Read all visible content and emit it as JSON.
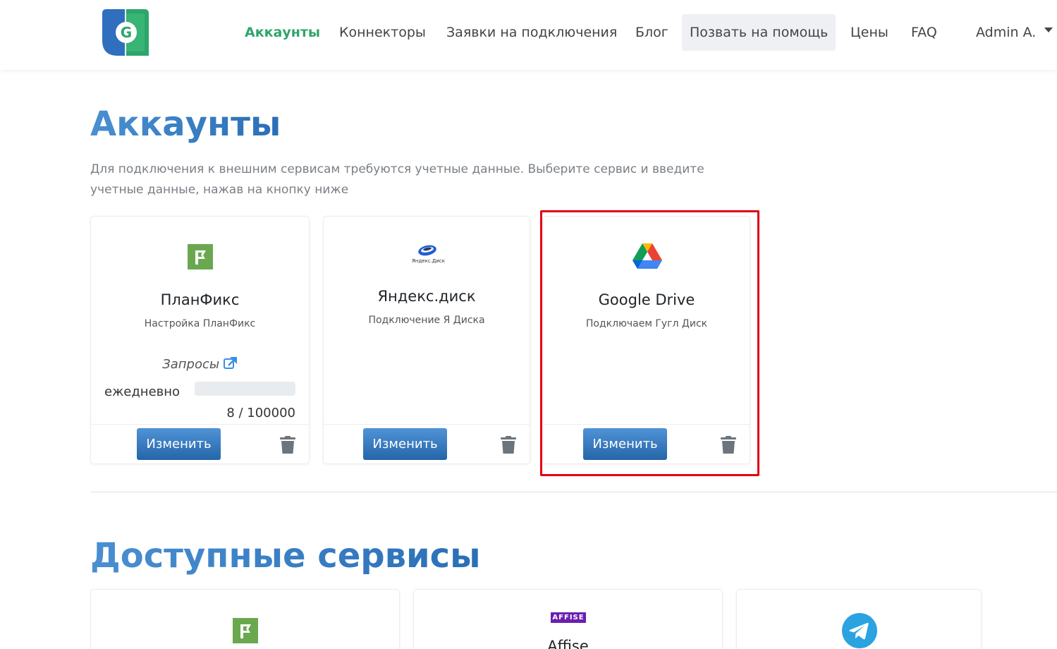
{
  "nav": {
    "items": [
      {
        "label": "Аккаунты",
        "active": true
      },
      {
        "label": "Коннекторы"
      },
      {
        "label": "Заявки на подключения"
      },
      {
        "label": "Блог"
      },
      {
        "label": "Позвать на помощь",
        "boxed": true
      },
      {
        "label": "Цены"
      },
      {
        "label": "FAQ"
      }
    ],
    "user": "Admin A."
  },
  "accounts": {
    "title": "Аккаунты",
    "subtitle": "Для подключения к внешним сервисам требуются учетные данные. Выберите сервис и введите учетные данные, нажав на кнопку ниже",
    "cards": [
      {
        "name": "ПланФикс",
        "description": "Настройка ПланФикс",
        "requests_label": "Запросы",
        "period_label": "ежедневно",
        "usage": "8 / 100000",
        "usage_fraction": 8e-05,
        "button": "Изменить",
        "icon": "planfix-logo-icon"
      },
      {
        "name": "Яндекс.диск",
        "description": "Подключение Я Диска",
        "logo_text": "Яндекс.Диск",
        "button": "Изменить",
        "icon": "yandex-disk-logo-icon"
      },
      {
        "name": "Google Drive",
        "description": "Подключаем Гугл Диск",
        "button": "Изменить",
        "icon": "google-drive-logo-icon"
      }
    ]
  },
  "services": {
    "title": "Доступные сервисы",
    "cards": [
      {
        "icon": "planfix-logo-icon"
      },
      {
        "logo_text": "AFFISE",
        "name": "Affise",
        "icon": "affise-logo-icon"
      },
      {
        "icon": "telegram-logo-icon"
      }
    ]
  },
  "colors": {
    "accent_green": "#2ea56b",
    "button_blue": "#2566a9",
    "highlight_red": "#e00012",
    "planfix_green": "#6aa84f",
    "affise_purple": "#6a1fb0",
    "telegram_blue": "#2aa3e0"
  }
}
